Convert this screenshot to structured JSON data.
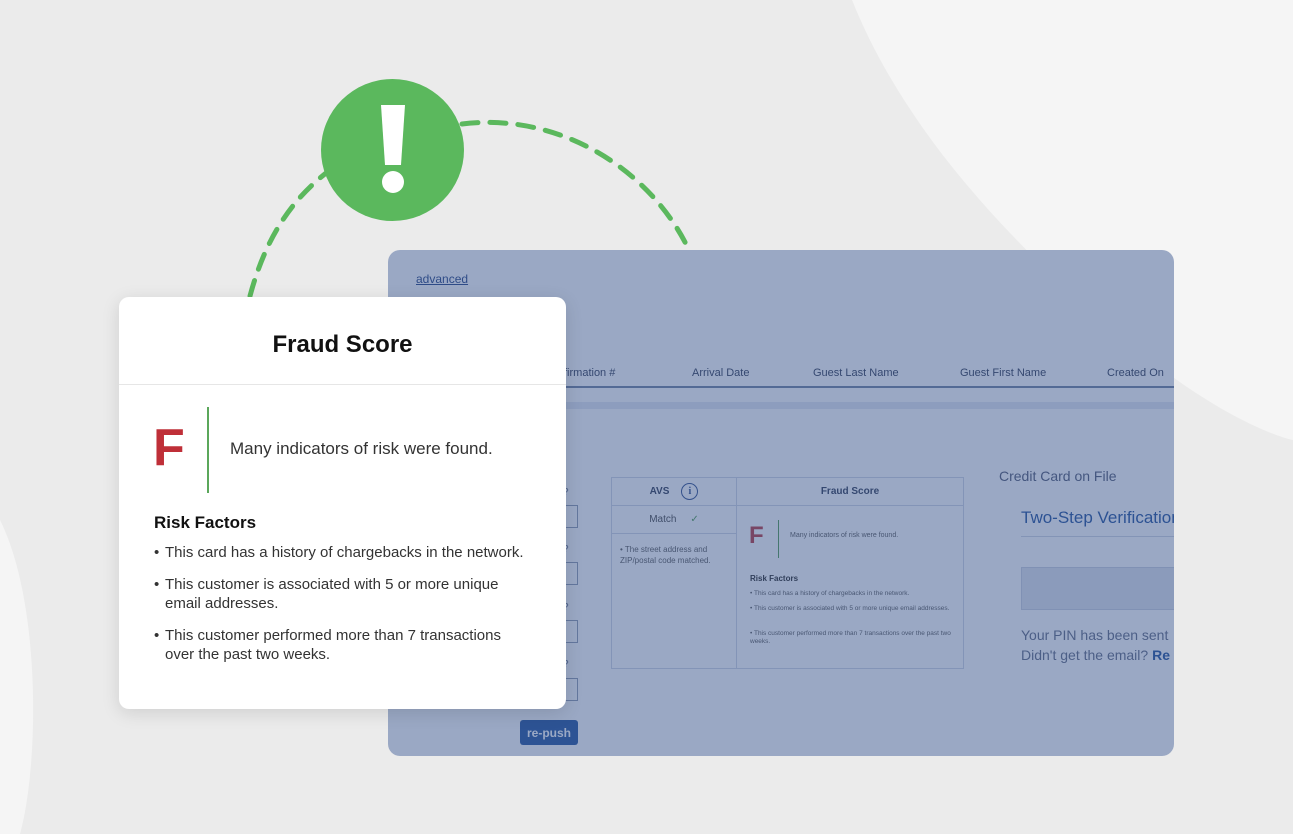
{
  "colors": {
    "accent_green": "#5bb85d",
    "grade_red": "#bf2f38",
    "link_blue": "#1b4b9a"
  },
  "icons": {
    "alert": "exclamation-icon",
    "info": "info-icon",
    "check": "check-icon"
  },
  "app": {
    "advanced_link": "advanced",
    "table_headers": [
      "firmation #",
      "Arrival Date",
      "Guest Last Name",
      "Guest First Name",
      "Created On"
    ],
    "avs": {
      "header": "AVS",
      "match_label": "Match",
      "note": "The street address and ZIP/postal code matched."
    },
    "mini_fraud": {
      "header": "Fraud Score",
      "grade": "F",
      "message": "Many indicators of risk were found.",
      "risk_title": "Risk Factors",
      "items": [
        "This card has a history of chargebacks in the network.",
        "This customer is associated with 5 or more unique email addresses.",
        "This customer performed more than 7 transactions over the past two weeks."
      ]
    },
    "credit_card_title": "Credit Card on File",
    "two_step": "Two-Step Verification",
    "pin_sent": "Your PIN has been sent",
    "no_email": "Didn't get the email?",
    "resend_partial": "Re",
    "repush_label": "re-push"
  },
  "card": {
    "title": "Fraud Score",
    "grade": "F",
    "message": "Many indicators of risk were found.",
    "risk_title": "Risk Factors",
    "items": [
      "This card has a history of chargebacks in the network.",
      "This customer is associated with 5 or more unique email addresses.",
      "This customer performed more than 7 transactions over the past two weeks."
    ]
  }
}
